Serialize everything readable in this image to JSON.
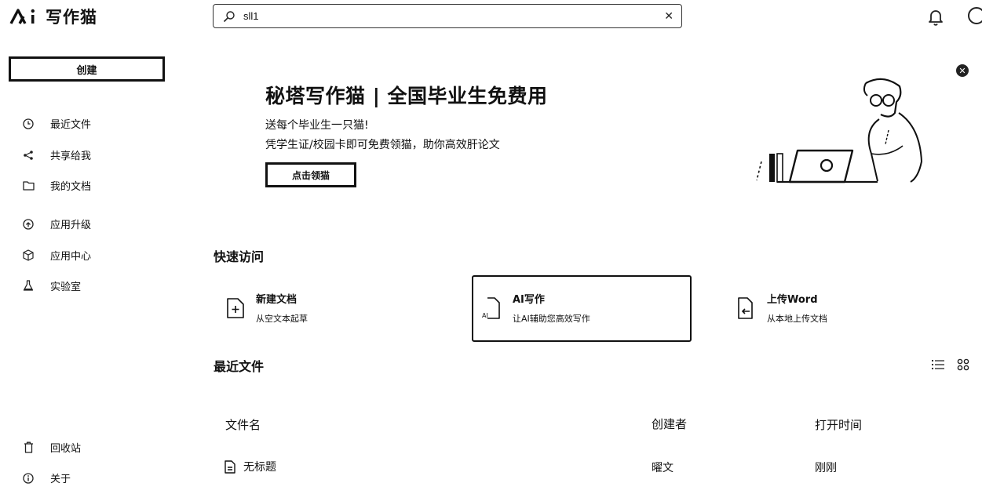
{
  "app": {
    "name": "写作猫"
  },
  "search": {
    "value": "sll1",
    "clear_icon": "close-icon"
  },
  "sidebar": {
    "create_label": "创建",
    "items": [
      {
        "label": "最近文件",
        "icon": "clock-icon"
      },
      {
        "label": "共享给我",
        "icon": "share-icon"
      },
      {
        "label": "我的文档",
        "icon": "folder-icon"
      },
      {
        "label": "应用升级",
        "icon": "upgrade-icon"
      },
      {
        "label": "应用中心",
        "icon": "cube-icon"
      },
      {
        "label": "实验室",
        "icon": "flask-icon"
      },
      {
        "label": "回收站",
        "icon": "trash-icon"
      },
      {
        "label": "关于",
        "icon": "info-icon"
      }
    ]
  },
  "banner": {
    "title": "秘塔写作猫 | 全国毕业生免费用",
    "sub1": "送每个毕业生一只猫!",
    "sub2": "凭学生证/校园卡即可免费领猫，助你高效肝论文",
    "button": "点击领猫"
  },
  "quick_access": {
    "title": "快速访问",
    "cards": [
      {
        "title": "新建文档",
        "desc": "从空文本起草",
        "icon": "new-doc-icon"
      },
      {
        "title": "AI写作",
        "desc": "让AI辅助您高效写作",
        "icon": "ai-doc-icon",
        "icon_text": "AI"
      },
      {
        "title": "上传Word",
        "desc": "从本地上传文档",
        "icon": "upload-doc-icon"
      }
    ]
  },
  "recent": {
    "title": "最近文件",
    "columns": [
      "文件名",
      "创建者",
      "打开时间"
    ],
    "rows": [
      {
        "name": "无标题",
        "creator": "曜文",
        "opened": "刚刚"
      }
    ]
  }
}
